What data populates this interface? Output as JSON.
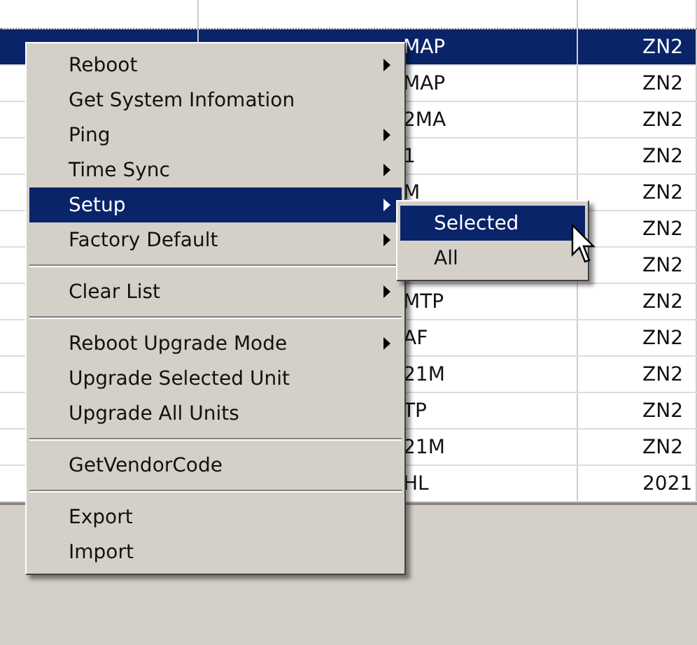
{
  "table": {
    "rows": [
      {
        "column_2": "MAP",
        "column_3": "ZN2",
        "selected": true
      },
      {
        "column_2": "MAP",
        "column_3": "ZN2",
        "selected": false
      },
      {
        "column_2": "2MA",
        "column_3": "ZN2",
        "selected": false
      },
      {
        "column_2": "1",
        "column_3": "ZN2",
        "selected": false
      },
      {
        "column_2": "M",
        "column_3": "ZN2",
        "selected": false
      },
      {
        "column_2": "",
        "column_3": "ZN2",
        "selected": false
      },
      {
        "column_2": "",
        "column_3": "ZN2",
        "selected": false
      },
      {
        "column_2": "MTP",
        "column_3": "ZN2",
        "selected": false
      },
      {
        "column_2": "AF",
        "column_3": "ZN2",
        "selected": false
      },
      {
        "column_2": "21M",
        "column_3": "ZN2",
        "selected": false
      },
      {
        "column_2": "TP",
        "column_3": "ZN2",
        "selected": false
      },
      {
        "column_2": "21M",
        "column_3": "ZN2",
        "selected": false
      },
      {
        "column_2": "HL",
        "column_3": "2021",
        "selected": false
      }
    ]
  },
  "context_menu": {
    "items": [
      {
        "kind": "item",
        "label": "Reboot",
        "has_submenu": true,
        "selected": false
      },
      {
        "kind": "item",
        "label": "Get System Infomation",
        "has_submenu": false,
        "selected": false
      },
      {
        "kind": "item",
        "label": "Ping",
        "has_submenu": true,
        "selected": false
      },
      {
        "kind": "item",
        "label": "Time Sync",
        "has_submenu": true,
        "selected": false
      },
      {
        "kind": "item",
        "label": "Setup",
        "has_submenu": true,
        "selected": true
      },
      {
        "kind": "item",
        "label": "Factory Default",
        "has_submenu": true,
        "selected": false
      },
      {
        "kind": "separator"
      },
      {
        "kind": "item",
        "label": "Clear List",
        "has_submenu": true,
        "selected": false
      },
      {
        "kind": "separator"
      },
      {
        "kind": "item",
        "label": "Reboot Upgrade Mode",
        "has_submenu": true,
        "selected": false
      },
      {
        "kind": "item",
        "label": "Upgrade Selected Unit",
        "has_submenu": false,
        "selected": false
      },
      {
        "kind": "item",
        "label": "Upgrade All Units",
        "has_submenu": false,
        "selected": false
      },
      {
        "kind": "separator"
      },
      {
        "kind": "item",
        "label": "GetVendorCode",
        "has_submenu": false,
        "selected": false
      },
      {
        "kind": "separator"
      },
      {
        "kind": "item",
        "label": "Export",
        "has_submenu": false,
        "selected": false
      },
      {
        "kind": "item",
        "label": "Import",
        "has_submenu": false,
        "selected": false
      }
    ]
  },
  "submenu": {
    "items": [
      {
        "label": "Selected",
        "selected": true
      },
      {
        "label": "All",
        "selected": false
      }
    ]
  }
}
